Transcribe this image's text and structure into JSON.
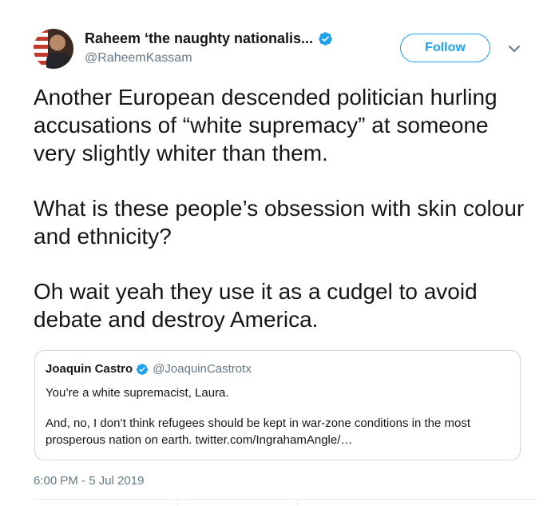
{
  "author": {
    "display_name": "Raheem ‘the naughty nationalis...",
    "handle": "@RaheemKassam",
    "verified": true
  },
  "follow_label": "Follow",
  "tweet_text": [
    "Another European descended politician hurling accusations of “white supremacy” at someone very slightly whiter than them.",
    "What is these people’s obsession with skin colour and ethnicity?",
    "Oh wait yeah they use it as a cudgel to avoid debate and destroy America."
  ],
  "quoted_tweet": {
    "display_name": "Joaquin Castro",
    "handle": "@JoaquinCastrotx",
    "verified": true,
    "text": [
      "You’re a white supremacist, Laura.",
      "And, no, I don’t think refugees should be kept in war-zone conditions in the most prosperous nation on earth. twitter.com/IngrahamAngle/…"
    ]
  },
  "timestamp": "6:00 PM - 5 Jul 2019",
  "colors": {
    "accent": "#1da1f2",
    "text": "#14171a",
    "muted": "#657786",
    "border": "#ccd6dd"
  },
  "icons": {
    "verified": "verified-badge-icon",
    "caret": "chevron-down-icon"
  }
}
